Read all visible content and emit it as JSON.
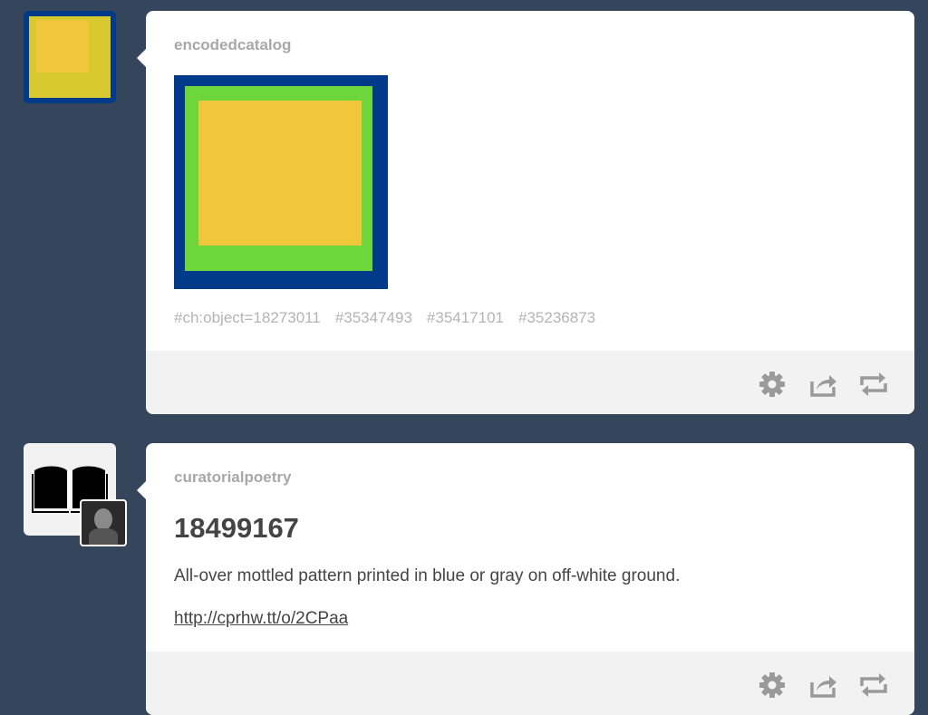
{
  "posts": [
    {
      "blog_name": "encodedcatalog",
      "tags": [
        "#ch:object=18273011",
        "#35347493",
        "#35417101",
        "#35236873"
      ],
      "image_colors": {
        "outer": "#003a88",
        "middle": "#6dd63a",
        "inner": "#f0c63a"
      },
      "avatar_colors": {
        "border": "#003a88",
        "outer": "#d9c930",
        "inner": "#f0c63a"
      }
    },
    {
      "blog_name": "curatorialpoetry",
      "title": "18499167",
      "text": "All-over mottled pattern printed in blue or gray on off-white ground.",
      "link": "http://cprhw.tt/o/2CPaa"
    }
  ],
  "footer_icons": [
    "gear-icon",
    "share-icon",
    "reblog-icon"
  ],
  "colors": {
    "background": "#35465c",
    "card": "#ffffff",
    "footer": "#f2f2f2"
  }
}
